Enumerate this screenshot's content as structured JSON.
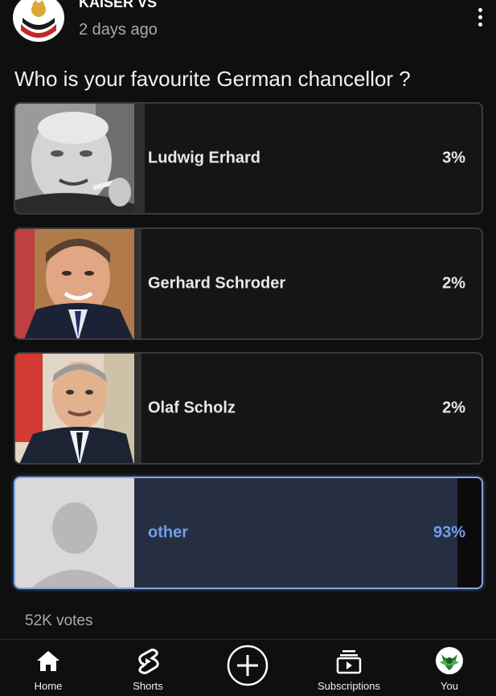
{
  "post": {
    "channel_name": "KAISER VS",
    "time_ago": "2 days ago",
    "question": "Who is your favourite German chancellor ?",
    "votes": "52K votes"
  },
  "options": [
    {
      "label": "Ludwig Erhard",
      "percent_text": "3%",
      "percent": 3,
      "selected": false
    },
    {
      "label": "Gerhard Schroder",
      "percent_text": "2%",
      "percent": 2,
      "selected": false
    },
    {
      "label": "Olaf Scholz",
      "percent_text": "2%",
      "percent": 2,
      "selected": false
    },
    {
      "label": "other",
      "percent_text": "93%",
      "percent": 93,
      "selected": true
    }
  ],
  "nav": {
    "items": [
      {
        "label": "Home",
        "icon": "home-icon"
      },
      {
        "label": "Shorts",
        "icon": "shorts-icon"
      },
      {
        "label": "",
        "icon": "create-icon"
      },
      {
        "label": "Subscriptions",
        "icon": "subscriptions-icon"
      },
      {
        "label": "You",
        "icon": "profile-avatar-icon"
      }
    ]
  },
  "colors": {
    "background": "#0f0f0f",
    "option_border": "#3a3a3a",
    "selected_border": "#7ea9e6",
    "selected_text": "#6fa0ea",
    "secondary_text": "#aaaaaa"
  }
}
